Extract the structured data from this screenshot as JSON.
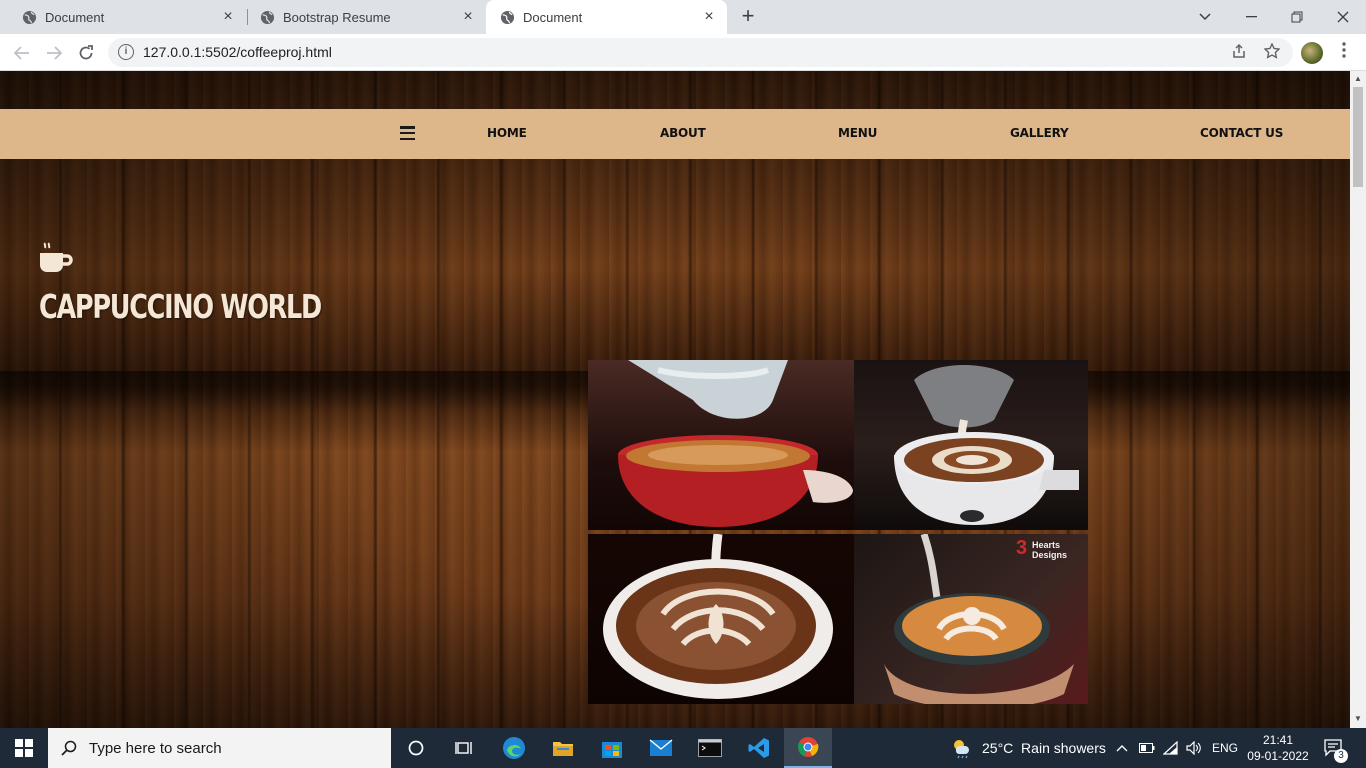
{
  "browser": {
    "tabs": [
      {
        "title": "Document",
        "active": false
      },
      {
        "title": "Bootstrap Resume",
        "active": false
      },
      {
        "title": "Document",
        "active": true
      }
    ],
    "url": "127.0.0.1:5502/coffeeproj.html"
  },
  "site": {
    "nav": [
      "HOME",
      "ABOUT",
      "MENU",
      "GALLERY",
      "CONTACT US"
    ],
    "hero_title": "CAPPUCCINO WORLD"
  },
  "taskbar": {
    "search_placeholder": "Type here to search",
    "weather": "25°C  Rain showers",
    "lang": "ENG",
    "time": "21:41",
    "date": "09-01-2022",
    "notifications": "3"
  }
}
